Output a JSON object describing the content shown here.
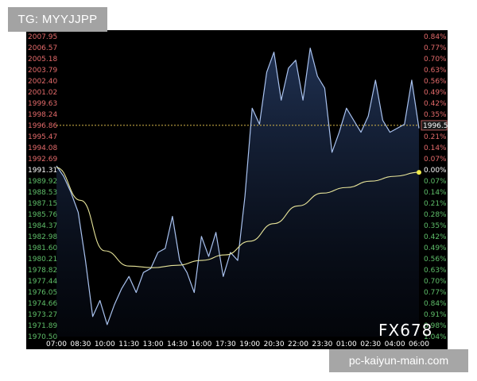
{
  "overlay": {
    "tg_label": "TG: MYYJJPP",
    "watermark": "FX678",
    "url_label": "pc-kaiyun-main.com"
  },
  "chart_data": {
    "type": "line",
    "grid": false,
    "price_ticks": [
      "2007.95",
      "2006.57",
      "2005.18",
      "2003.79",
      "2002.40",
      "2001.02",
      "1999.63",
      "1998.24",
      "1996.86",
      "1995.47",
      "1994.08",
      "1992.69",
      "1991.31",
      "1989.92",
      "1988.53",
      "1987.15",
      "1985.76",
      "1984.37",
      "1982.98",
      "1981.60",
      "1980.21",
      "1978.82",
      "1977.44",
      "1976.05",
      "1974.66",
      "1973.27",
      "1971.89",
      "1970.50"
    ],
    "percent_ticks": [
      "0.84%",
      "0.77%",
      "0.70%",
      "0.63%",
      "0.56%",
      "0.49%",
      "0.42%",
      "0.35%",
      "0.28%",
      "0.21%",
      "0.14%",
      "0.07%",
      "0.00%",
      "0.07%",
      "0.14%",
      "0.21%",
      "0.28%",
      "0.35%",
      "0.42%",
      "0.49%",
      "0.56%",
      "0.63%",
      "0.70%",
      "0.77%",
      "0.84%",
      "0.91%",
      "0.98%",
      "1.04%"
    ],
    "x_ticks": [
      "07:00",
      "08:30",
      "10:00",
      "11:30",
      "13:00",
      "14:30",
      "16:00",
      "17:30",
      "19:00",
      "20:30",
      "22:00",
      "23:30",
      "01:00",
      "02:30",
      "04:00",
      "06:00"
    ],
    "reference_price": 1991.31,
    "current_price": 1996.86,
    "current_price_label": "1996.53",
    "ylim": [
      1970.5,
      2007.95
    ],
    "series": [
      {
        "color": "#a9c2ef",
        "x": [
          0,
          0.3,
          0.6,
          0.9,
          1.2,
          1.5,
          1.8,
          2.1,
          2.4,
          2.7,
          3.0,
          3.3,
          3.6,
          3.9,
          4.2,
          4.5,
          4.8,
          5.1,
          5.4,
          5.7,
          6.0,
          6.3,
          6.6,
          6.9,
          7.2,
          7.5,
          7.8,
          8.1,
          8.4,
          8.7,
          9.0,
          9.3,
          9.6,
          9.9,
          10.2,
          10.5,
          10.8,
          11.1,
          11.4,
          11.7,
          12.0,
          12.3,
          12.6,
          12.9,
          13.2,
          13.5,
          13.8,
          14.1,
          14.4,
          14.7,
          15.0
        ],
        "values": [
          1991.8,
          1990.5,
          1988.5,
          1986.0,
          1980.0,
          1973.0,
          1975.0,
          1972.0,
          1974.5,
          1976.5,
          1978.0,
          1976.0,
          1978.5,
          1979.0,
          1981.0,
          1981.5,
          1985.5,
          1980.0,
          1978.5,
          1976.0,
          1983.0,
          1980.5,
          1983.5,
          1978.0,
          1981.0,
          1980.0,
          1988.0,
          1999.0,
          1997.0,
          2003.5,
          2006.0,
          2000.0,
          2004.0,
          2005.0,
          2000.0,
          2006.5,
          2003.0,
          2001.5,
          1993.5,
          1996.0,
          1999.0,
          1997.5,
          1996.0,
          1998.0,
          2002.5,
          1997.5,
          1996.0,
          1996.5,
          1997.0,
          2002.5,
          1996.5
        ]
      },
      {
        "color": "#e8e59a",
        "x": [
          0,
          1,
          2,
          3,
          4,
          5,
          6,
          7,
          8,
          9,
          10,
          11,
          12,
          13,
          14,
          15
        ],
        "values": [
          1991.6,
          1987.5,
          1981.2,
          1979.3,
          1979.1,
          1979.4,
          1980.0,
          1980.7,
          1982.4,
          1984.6,
          1986.8,
          1988.4,
          1989.1,
          1989.9,
          1990.5,
          1991.0
        ]
      }
    ]
  }
}
